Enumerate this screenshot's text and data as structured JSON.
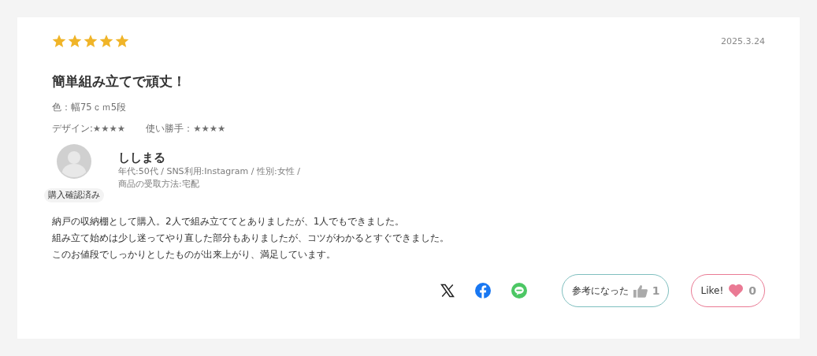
{
  "review": {
    "stars": 5,
    "date": "2025.3.24",
    "title": "簡単組み立てで頑丈！",
    "variant": "色：幅75ｃｍ5段",
    "ratings": [
      {
        "label": "デザイン:★★★★"
      },
      {
        "label": "使い勝手：★★★★"
      }
    ],
    "reviewer": {
      "name": "ししまる",
      "verified_badge": "購入確認済み",
      "profile_line": "年代:50代 / SNS利用:Instagram / 性別:女性 /",
      "delivery": "商品の受取方法:宅配"
    },
    "body": [
      "納戸の収納棚として購入。2人で組み立ててとありましたが、1人でもできました。",
      "組み立て始めは少し迷ってやり直した部分もありましたが、コツがわかるとすぐできました。",
      "このお値段でしっかりとしたものが出来上がり、満足しています。"
    ],
    "share": [
      {
        "kind": "x"
      },
      {
        "kind": "facebook"
      },
      {
        "kind": "line"
      }
    ],
    "helpful": {
      "label": "参考になった",
      "count": "1"
    },
    "like": {
      "label": "Like!",
      "count": "0"
    }
  }
}
